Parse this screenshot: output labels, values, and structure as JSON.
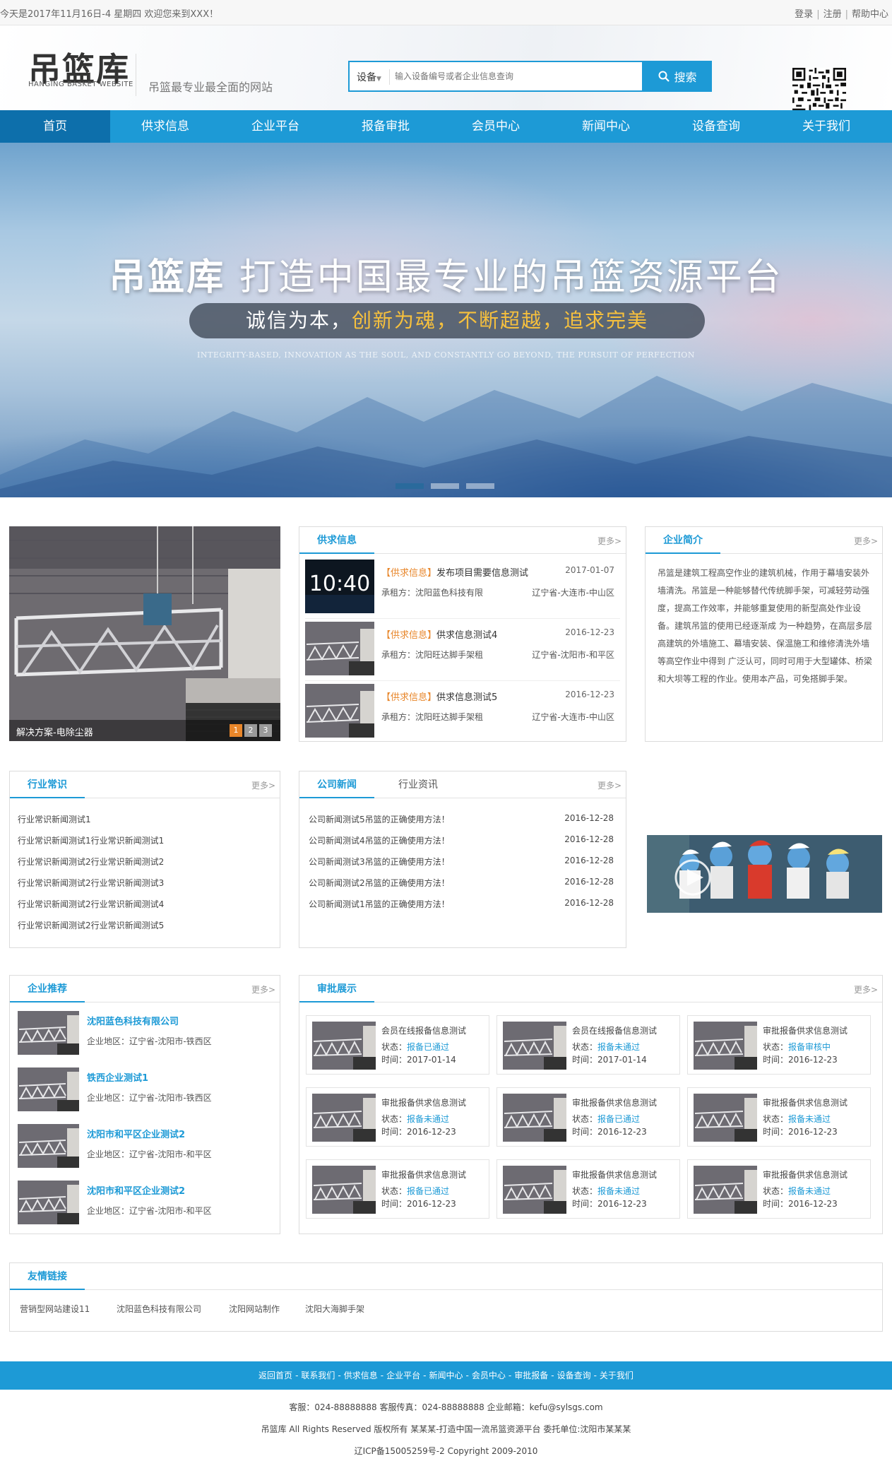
{
  "topbar": {
    "greeting": "今天是2017年11月16日-4 星期四 欢迎您来到XXX！",
    "login": "登录",
    "register": "注册",
    "help": "帮助中心",
    "sep": "|"
  },
  "header": {
    "logo": "吊篮库",
    "logo_sub": "HANGING BASKET WEBSITE",
    "slogan": "吊篮最专业最全面的网站",
    "search": {
      "category": "设备",
      "placeholder": "输入设备编号或者企业信息查询",
      "button": "搜索"
    }
  },
  "nav": [
    "首页",
    "供求信息",
    "企业平台",
    "报备审批",
    "会员中心",
    "新闻中心",
    "设备查询",
    "关于我们"
  ],
  "banner": {
    "brand": "吊篮库",
    "title": "打造中国最专业的吊篮资源平台",
    "pill": {
      "a": "诚信为本，",
      "b": "创新为魂，",
      "c": "不断超越，",
      "d": "追求完美"
    },
    "en": "INTEGRITY-BASED, INNOVATION AS THE SOUL, AND CONSTANTLY GO BEYOND, THE PURSUIT OF PERFECTION",
    "active_slide": 1,
    "slide_count": 3
  },
  "slider": {
    "caption": "解决方案-电除尘器",
    "pages": [
      "1",
      "2",
      "3"
    ],
    "active": 1
  },
  "more": "更多>",
  "supply": {
    "title": "供求信息",
    "tag": "【供求信息】",
    "company_prefix": "承租方：",
    "items": [
      {
        "title": "发布项目需要信息测试",
        "date": "2017-01-07",
        "company": "沈阳蓝色科技有限",
        "location": "辽宁省-大连市-中山区",
        "clock": "10:40"
      },
      {
        "title": "供求信息测试4",
        "date": "2016-12-23",
        "company": "沈阳旺达脚手架租",
        "location": "辽宁省-沈阳市-和平区"
      },
      {
        "title": "供求信息测试5",
        "date": "2016-12-23",
        "company": "沈阳旺达脚手架租",
        "location": "辽宁省-大连市-中山区"
      }
    ]
  },
  "intro": {
    "title": "企业简介",
    "text": "吊篮是建筑工程高空作业的建筑机械，作用于幕墙安装外墙清洗。吊篮是一种能够替代传统脚手架，可减轻劳动强度，提高工作效率，并能够重复使用的新型高处作业设备。建筑吊篮的使用已经逐渐成 为一种趋势，在高层多层高建筑的外墙施工、幕墙安装、保温施工和维修清洗外墙等高空作业中得到 广泛认可，同时可用于大型罐体、桥梁和大坝等工程的作业。使用本产品，可免搭脚手架。"
  },
  "industry": {
    "title": "行业常识",
    "items": [
      "行业常识新闻测试1",
      "行业常识新闻测试1行业常识新闻测试1",
      "行业常识新闻测试2行业常识新闻测试2",
      "行业常识新闻测试2行业常识新闻测试3",
      "行业常识新闻测试2行业常识新闻测试4",
      "行业常识新闻测试2行业常识新闻测试5"
    ]
  },
  "news": {
    "tab1": "公司新闻",
    "tab2": "行业资讯",
    "items": [
      {
        "t": "公司新闻测试5吊篮的正确使用方法！",
        "d": "2016-12-28"
      },
      {
        "t": "公司新闻测试4吊篮的正确使用方法！",
        "d": "2016-12-28"
      },
      {
        "t": "公司新闻测试3吊篮的正确使用方法！",
        "d": "2016-12-28"
      },
      {
        "t": "公司新闻测试2吊篮的正确使用方法！",
        "d": "2016-12-28"
      },
      {
        "t": "公司新闻测试1吊篮的正确使用方法！",
        "d": "2016-12-28"
      }
    ]
  },
  "enterprise": {
    "title": "企业推荐",
    "area_prefix": "企业地区：",
    "items": [
      {
        "name": "沈阳蓝色科技有限公司",
        "area": "辽宁省-沈阳市-铁西区"
      },
      {
        "name": "铁西企业测试1",
        "area": "辽宁省-沈阳市-铁西区"
      },
      {
        "name": "沈阳市和平区企业测试2",
        "area": "辽宁省-沈阳市-和平区"
      },
      {
        "name": "沈阳市和平区企业测试2",
        "area": "辽宁省-沈阳市-和平区"
      }
    ]
  },
  "approval": {
    "title": "审批展示",
    "status_prefix": "状态：",
    "time_prefix": "时间：",
    "items": [
      {
        "t": "会员在线报备信息测试",
        "s": "报备已通过",
        "d": "2017-01-14"
      },
      {
        "t": "会员在线报备信息测试",
        "s": "报备未通过",
        "d": "2017-01-14"
      },
      {
        "t": "审批报备供求信息测试",
        "s": "报备审核中",
        "d": "2016-12-23"
      },
      {
        "t": "审批报备供求信息测试",
        "s": "报备未通过",
        "d": "2016-12-23"
      },
      {
        "t": "审批报备供求信息测试",
        "s": "报备已通过",
        "d": "2016-12-23"
      },
      {
        "t": "审批报备供求信息测试",
        "s": "报备未通过",
        "d": "2016-12-23"
      },
      {
        "t": "审批报备供求信息测试",
        "s": "报备已通过",
        "d": "2016-12-23"
      },
      {
        "t": "审批报备供求信息测试",
        "s": "报备未通过",
        "d": "2016-12-23"
      },
      {
        "t": "审批报备供求信息测试",
        "s": "报备未通过",
        "d": "2016-12-23"
      }
    ]
  },
  "links": {
    "title": "友情链接",
    "items": [
      "营销型网站建设11",
      "沈阳蓝色科技有限公司",
      "沈阳网站制作",
      "沈阳大海脚手架"
    ]
  },
  "footer": {
    "nav": [
      "返回首页",
      "联系我们",
      "供求信息",
      "企业平台",
      "新闻中心",
      "会员中心",
      "审批报备",
      "设备查询",
      "关于我们"
    ],
    "nav_sep": "-",
    "contact": "客服：024-88888888 客服传真：024-88888888 企业邮箱：kefu@sylsgs.com",
    "copyright": "吊篮库 All Rights Reserved 版权所有 某某某-打造中国一流吊篮资源平台 委托单位:沈阳市某某某",
    "icp": "辽ICP备15005259号-2 Copyright 2009-2010"
  },
  "colors": {
    "accent": "#1d9ad6",
    "nav_active": "#0d6fab",
    "tag": "#e8862a"
  }
}
